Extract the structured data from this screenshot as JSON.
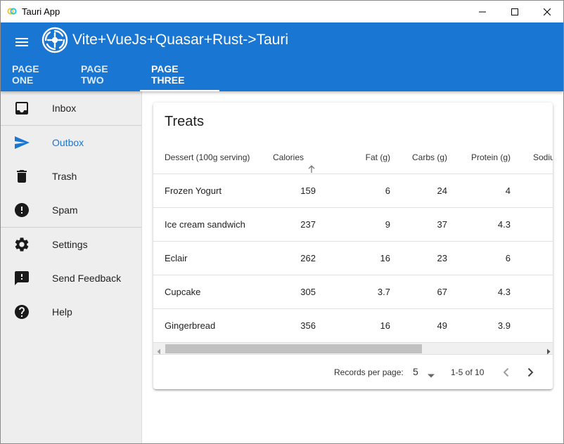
{
  "window": {
    "title": "Tauri App"
  },
  "header": {
    "title": "Vite+VueJs+Quasar+Rust->Tauri",
    "tabs": [
      {
        "label": "PAGE ONE"
      },
      {
        "label": "PAGE TWO"
      },
      {
        "label": "PAGE THREE",
        "active": true
      }
    ]
  },
  "drawer": {
    "items": [
      {
        "label": "Inbox",
        "icon": "inbox-icon"
      },
      {
        "label": "Outbox",
        "icon": "send-icon",
        "active": true
      },
      {
        "label": "Trash",
        "icon": "trash-icon"
      },
      {
        "label": "Spam",
        "icon": "error-icon"
      },
      {
        "label": "Settings",
        "icon": "gear-icon"
      },
      {
        "label": "Send Feedback",
        "icon": "feedback-icon"
      },
      {
        "label": "Help",
        "icon": "help-icon"
      }
    ]
  },
  "table": {
    "title": "Treats",
    "columns": [
      "Dessert (100g serving)",
      "Calories",
      "Fat (g)",
      "Carbs (g)",
      "Protein (g)",
      "Sodiu"
    ],
    "rows": [
      [
        "Frozen Yogurt",
        "159",
        "6",
        "24",
        "4"
      ],
      [
        "Ice cream sandwich",
        "237",
        "9",
        "37",
        "4.3"
      ],
      [
        "Eclair",
        "262",
        "16",
        "23",
        "6"
      ],
      [
        "Cupcake",
        "305",
        "3.7",
        "67",
        "4.3"
      ],
      [
        "Gingerbread",
        "356",
        "16",
        "49",
        "3.9"
      ]
    ],
    "records_label": "Records per page:",
    "records_value": "5",
    "range_text": "1-5 of 10"
  },
  "colors": {
    "primary": "#1976d2",
    "drawer_bg": "#eeeeee"
  }
}
